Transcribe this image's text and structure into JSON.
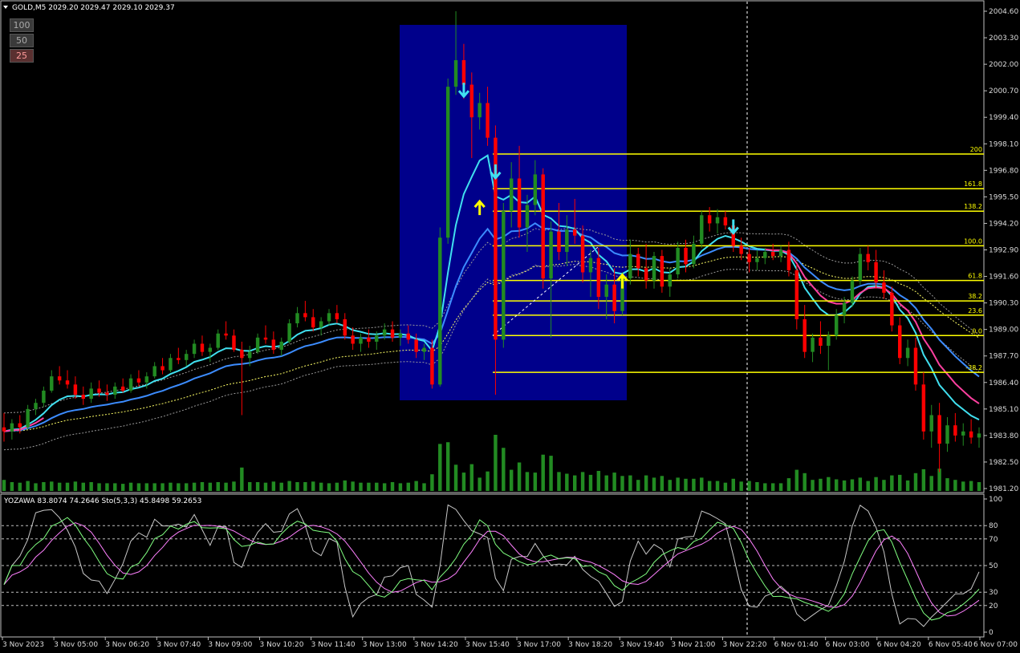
{
  "main_chart": {
    "header": "GOLD,M5  2029.20 2029.47 2029.10 2029.37",
    "price_ticks": [
      "2004.60",
      "2003.30",
      "2002.00",
      "2000.70",
      "1999.40",
      "1998.10",
      "1996.80",
      "1995.50",
      "1994.20",
      "1992.90",
      "1991.60",
      "1990.30",
      "1989.00",
      "1987.70",
      "1986.40",
      "1985.10",
      "1983.80",
      "1982.50",
      "1981.20"
    ],
    "fib_levels": [
      {
        "label": "200",
        "price": 1997.6
      },
      {
        "label": "161.8",
        "price": 1995.9
      },
      {
        "label": "138.2",
        "price": 1994.8
      },
      {
        "label": "100.0",
        "price": 1993.1
      },
      {
        "label": "61.8",
        "price": 1991.4
      },
      {
        "label": "38.2",
        "price": 1990.4
      },
      {
        "label": "23.6",
        "price": 1989.7
      },
      {
        "label": "0.0",
        "price": 1988.7
      },
      {
        "label": "-38.2",
        "price": 1986.9
      }
    ],
    "buttons": [
      "100",
      "50",
      "25"
    ]
  },
  "sub_chart": {
    "header": "YOZAWA 83.8074 74.2646  Sto(5,3,3) 45.8498 59.2653",
    "level_ticks": [
      "100",
      "80",
      "70",
      "50",
      "30",
      "20",
      "0"
    ]
  },
  "time_labels": [
    "3 Nov 2023",
    "3 Nov 05:00",
    "3 Nov 06:20",
    "3 Nov 07:40",
    "3 Nov 09:00",
    "3 Nov 10:20",
    "3 Nov 11:40",
    "3 Nov 13:00",
    "3 Nov 14:20",
    "3 Nov 15:40",
    "3 Nov 17:00",
    "3 Nov 18:20",
    "3 Nov 19:40",
    "3 Nov 21:00",
    "3 Nov 22:20",
    "6 Nov 01:40",
    "6 Nov 03:00",
    "6 Nov 04:20",
    "6 Nov 05:40",
    "6 Nov 07:00"
  ],
  "colors": {
    "background": "#000000",
    "bull": "#228b22",
    "bear": "#ff0000",
    "highlight_box": "#00008b",
    "fib_line": "#ffff00",
    "ma_fast": "#40e0f0",
    "ma_mid": "#3c8cff",
    "ma_pink": "#ff40a0",
    "volume": "#228b22",
    "yozawa": "#c8c8c8",
    "sto_main": "#80ff80",
    "sto_signal": "#ff80ff"
  },
  "chart_data": {
    "type": "candlestick",
    "symbol": "GOLD",
    "timeframe": "M5",
    "ylim": [
      1981.2,
      2004.6
    ],
    "x_range": [
      "3 Nov 2023",
      "6 Nov 07:00"
    ],
    "bars": [
      [
        1984.2,
        1984.9,
        1983.5,
        1984.0
      ],
      [
        1984.0,
        1984.6,
        1983.6,
        1984.4
      ],
      [
        1984.4,
        1984.8,
        1983.9,
        1984.2
      ],
      [
        1984.2,
        1985.3,
        1984.1,
        1985.1
      ],
      [
        1985.1,
        1985.6,
        1984.8,
        1985.4
      ],
      [
        1985.4,
        1986.2,
        1985.2,
        1986.0
      ],
      [
        1986.0,
        1987.0,
        1985.9,
        1986.7
      ],
      [
        1986.7,
        1987.2,
        1986.3,
        1986.5
      ],
      [
        1986.5,
        1987.0,
        1986.1,
        1986.3
      ],
      [
        1986.3,
        1986.7,
        1985.6,
        1985.8
      ],
      [
        1985.8,
        1986.2,
        1985.3,
        1985.6
      ],
      [
        1985.6,
        1986.4,
        1985.4,
        1986.1
      ],
      [
        1986.1,
        1986.5,
        1985.7,
        1985.9
      ],
      [
        1985.9,
        1986.3,
        1985.5,
        1985.8
      ],
      [
        1985.8,
        1986.4,
        1985.6,
        1986.2
      ],
      [
        1986.2,
        1986.6,
        1985.9,
        1986.0
      ],
      [
        1986.0,
        1986.8,
        1985.9,
        1986.6
      ],
      [
        1986.6,
        1987.0,
        1986.2,
        1986.4
      ],
      [
        1986.4,
        1986.9,
        1986.1,
        1986.7
      ],
      [
        1986.7,
        1987.4,
        1986.6,
        1987.2
      ],
      [
        1987.2,
        1987.6,
        1986.8,
        1987.0
      ],
      [
        1987.0,
        1987.8,
        1986.9,
        1987.6
      ],
      [
        1987.6,
        1988.1,
        1987.3,
        1987.5
      ],
      [
        1987.5,
        1988.0,
        1987.2,
        1987.8
      ],
      [
        1987.8,
        1988.5,
        1987.6,
        1988.3
      ],
      [
        1988.3,
        1988.7,
        1987.7,
        1987.9
      ],
      [
        1987.9,
        1988.3,
        1987.4,
        1988.1
      ],
      [
        1988.1,
        1989.0,
        1988.0,
        1988.8
      ],
      [
        1988.8,
        1989.4,
        1988.5,
        1988.7
      ],
      [
        1988.7,
        1989.0,
        1987.9,
        1988.0
      ],
      [
        1988.0,
        1988.4,
        1984.8,
        1987.6
      ],
      [
        1987.6,
        1988.2,
        1987.2,
        1987.9
      ],
      [
        1987.9,
        1988.8,
        1987.8,
        1988.6
      ],
      [
        1988.6,
        1989.2,
        1988.3,
        1988.5
      ],
      [
        1988.5,
        1988.9,
        1987.8,
        1988.0
      ],
      [
        1988.0,
        1988.6,
        1987.7,
        1988.4
      ],
      [
        1988.4,
        1989.5,
        1988.3,
        1989.3
      ],
      [
        1989.3,
        1990.1,
        1989.1,
        1989.8
      ],
      [
        1989.8,
        1990.4,
        1989.4,
        1989.6
      ],
      [
        1989.6,
        1990.0,
        1988.9,
        1989.1
      ],
      [
        1989.1,
        1989.6,
        1988.7,
        1989.4
      ],
      [
        1989.4,
        1990.0,
        1989.2,
        1989.8
      ],
      [
        1989.8,
        1990.2,
        1989.3,
        1989.5
      ],
      [
        1989.5,
        1989.8,
        1988.5,
        1988.7
      ],
      [
        1988.7,
        1989.1,
        1988.0,
        1988.3
      ],
      [
        1988.3,
        1988.8,
        1987.9,
        1988.6
      ],
      [
        1988.6,
        1989.0,
        1988.1,
        1988.4
      ],
      [
        1988.4,
        1988.9,
        1988.0,
        1988.7
      ],
      [
        1988.7,
        1989.3,
        1988.5,
        1989.0
      ],
      [
        1989.0,
        1989.4,
        1988.4,
        1988.6
      ],
      [
        1988.6,
        1989.0,
        1988.2,
        1988.8
      ],
      [
        1988.8,
        1989.2,
        1988.3,
        1988.5
      ],
      [
        1988.5,
        1988.8,
        1987.6,
        1987.9
      ],
      [
        1987.9,
        1988.3,
        1987.5,
        1988.1
      ],
      [
        1988.1,
        1988.5,
        1986.1,
        1986.3
      ],
      [
        1986.3,
        1994.0,
        1986.2,
        1993.5
      ],
      [
        1993.5,
        2001.3,
        1993.2,
        2000.9
      ],
      [
        2000.9,
        2004.6,
        2000.5,
        2002.2
      ],
      [
        2002.2,
        2003.0,
        2000.3,
        2001.0
      ],
      [
        2001.0,
        2001.6,
        1997.4,
        1999.4
      ],
      [
        1999.4,
        2000.6,
        1998.8,
        2000.1
      ],
      [
        2000.1,
        2000.9,
        1998.0,
        1998.4
      ],
      [
        1998.4,
        1999.0,
        1985.8,
        1988.5
      ],
      [
        1988.5,
        1995.2,
        1988.1,
        1994.8
      ],
      [
        1994.8,
        1997.2,
        1994.0,
        1996.4
      ],
      [
        1996.4,
        1998.0,
        1993.5,
        1994.0
      ],
      [
        1994.0,
        1995.6,
        1992.8,
        1995.1
      ],
      [
        1995.1,
        1997.3,
        1994.6,
        1996.6
      ],
      [
        1996.6,
        1996.9,
        1991.0,
        1991.5
      ],
      [
        1991.5,
        1994.3,
        1988.6,
        1993.8
      ],
      [
        1993.8,
        1995.2,
        1992.4,
        1992.8
      ],
      [
        1992.8,
        1994.6,
        1992.1,
        1993.9
      ],
      [
        1993.9,
        1995.4,
        1993.2,
        1993.6
      ],
      [
        1993.6,
        1994.1,
        1991.3,
        1991.8
      ],
      [
        1991.8,
        1992.9,
        1990.6,
        1992.5
      ],
      [
        1992.5,
        1993.0,
        1990.0,
        1990.6
      ],
      [
        1990.6,
        1991.7,
        1989.5,
        1991.2
      ],
      [
        1991.2,
        1992.0,
        1989.3,
        1989.9
      ],
      [
        1989.9,
        1991.8,
        1989.7,
        1991.5
      ],
      [
        1991.5,
        1993.4,
        1991.2,
        1992.7
      ],
      [
        1992.7,
        1993.0,
        1991.6,
        1992.0
      ],
      [
        1992.0,
        1993.2,
        1991.0,
        1991.4
      ],
      [
        1991.4,
        1992.8,
        1991.0,
        1992.6
      ],
      [
        1992.6,
        1992.9,
        1990.8,
        1991.1
      ],
      [
        1991.1,
        1992.0,
        1990.6,
        1991.7
      ],
      [
        1991.7,
        1993.3,
        1991.5,
        1993.0
      ],
      [
        1993.0,
        1993.4,
        1991.8,
        1992.2
      ],
      [
        1992.2,
        1993.6,
        1992.0,
        1993.2
      ],
      [
        1993.2,
        1994.8,
        1993.0,
        1994.6
      ],
      [
        1994.6,
        1995.0,
        1993.8,
        1994.2
      ],
      [
        1994.2,
        1994.9,
        1993.7,
        1994.5
      ],
      [
        1994.5,
        1994.8,
        1993.9,
        1994.1
      ],
      [
        1994.1,
        1994.4,
        1992.8,
        1993.1
      ],
      [
        1993.1,
        1993.5,
        1992.4,
        1992.7
      ],
      [
        1992.7,
        1993.0,
        1991.8,
        1992.3
      ],
      [
        1992.3,
        1992.9,
        1991.9,
        1992.5
      ],
      [
        1992.5,
        1993.0,
        1992.2,
        1992.8
      ],
      [
        1992.8,
        1993.2,
        1992.4,
        1992.6
      ],
      [
        1992.6,
        1993.1,
        1992.3,
        1992.9
      ],
      [
        1992.9,
        1993.3,
        1991.6,
        1991.9
      ],
      [
        1991.9,
        1992.2,
        1989.0,
        1989.5
      ],
      [
        1989.5,
        1990.2,
        1987.6,
        1987.9
      ],
      [
        1987.9,
        1988.8,
        1987.4,
        1988.6
      ],
      [
        1988.6,
        1989.4,
        1987.8,
        1988.2
      ],
      [
        1988.2,
        1988.9,
        1987.0,
        1988.7
      ],
      [
        1988.7,
        1990.0,
        1988.5,
        1989.7
      ],
      [
        1989.7,
        1990.6,
        1989.3,
        1990.3
      ],
      [
        1990.3,
        1991.6,
        1990.1,
        1991.4
      ],
      [
        1991.4,
        1993.0,
        1991.2,
        1992.7
      ],
      [
        1992.7,
        1993.1,
        1991.9,
        1992.3
      ],
      [
        1992.3,
        1992.9,
        1991.0,
        1991.3
      ],
      [
        1991.3,
        1991.9,
        1990.5,
        1990.8
      ],
      [
        1990.8,
        1991.1,
        1988.9,
        1989.2
      ],
      [
        1989.2,
        1989.6,
        1987.3,
        1987.6
      ],
      [
        1987.6,
        1988.5,
        1987.2,
        1988.1
      ],
      [
        1988.1,
        1988.6,
        1986.0,
        1986.3
      ],
      [
        1986.3,
        1986.9,
        1983.6,
        1984.0
      ],
      [
        1984.0,
        1985.3,
        1983.2,
        1984.8
      ],
      [
        1984.8,
        1985.4,
        1982.0,
        1983.4
      ],
      [
        1983.4,
        1984.7,
        1983.0,
        1984.3
      ],
      [
        1984.3,
        1984.9,
        1983.5,
        1983.8
      ],
      [
        1983.8,
        1984.4,
        1983.3,
        1984.0
      ],
      [
        1984.0,
        1984.6,
        1983.4,
        1983.7
      ],
      [
        1983.7,
        1984.2,
        1983.2,
        1983.9
      ]
    ],
    "fib_levels": [
      {
        "ratio": "200",
        "price": 1997.6
      },
      {
        "ratio": "161.8",
        "price": 1995.9
      },
      {
        "ratio": "138.2",
        "price": 1994.8
      },
      {
        "ratio": "100.0",
        "price": 1993.1
      },
      {
        "ratio": "61.8",
        "price": 1991.4
      },
      {
        "ratio": "38.2",
        "price": 1990.4
      },
      {
        "ratio": "23.6",
        "price": 1989.7
      },
      {
        "ratio": "0.0",
        "price": 1988.7
      },
      {
        "ratio": "-38.2",
        "price": 1986.9
      }
    ],
    "signals": [
      {
        "type": "sell",
        "bar": 58,
        "price": 2000.7
      },
      {
        "type": "sell",
        "bar": 62,
        "price": 1996.7
      },
      {
        "type": "buy",
        "bar": 60,
        "price": 1995.0
      },
      {
        "type": "buy",
        "bar": 78,
        "price": 1991.4
      },
      {
        "type": "sell",
        "bar": 92,
        "price": 1994.0
      }
    ],
    "indicator": {
      "name": "YOZAWA / Sto(5,3,3)",
      "yozawa": 83.8074,
      "yozawa_signal": 74.2646,
      "sto_main": 45.8498,
      "sto_signal": 59.2653,
      "ylim": [
        0,
        100
      ],
      "levels": [
        20,
        30,
        50,
        70,
        80
      ]
    }
  }
}
